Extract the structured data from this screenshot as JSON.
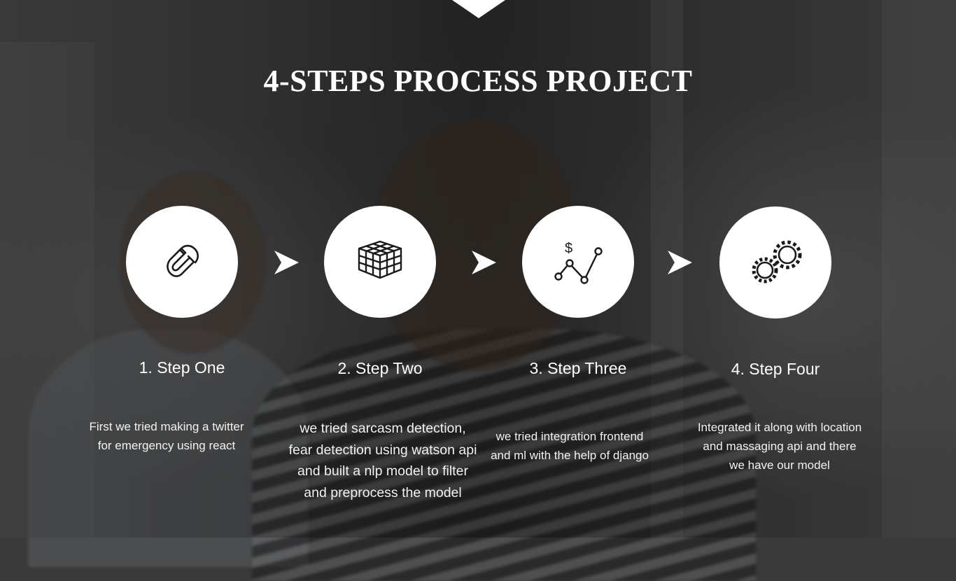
{
  "title": "4-STEPS PROCESS PROJECT",
  "steps": [
    {
      "title": "1. Step One",
      "description": "First we tried making a twitter for emergency using react",
      "icon": "magnet-icon"
    },
    {
      "title": "2. Step Two",
      "description": "we tried sarcasm detection, fear detection using watson api and built a nlp model to filter and preprocess the model",
      "icon": "cube-grid-icon"
    },
    {
      "title": "3. Step Three",
      "description": "we tried integration frontend and ml with the help of django",
      "icon": "dollar-line-chart-icon"
    },
    {
      "title": "4. Step Four",
      "description": "Integrated it along with location and massaging api and there we have our model",
      "icon": "gears-icon"
    }
  ],
  "colors": {
    "circle": "#ffffff",
    "icon": "#1a1a1a",
    "text": "#ffffff"
  }
}
